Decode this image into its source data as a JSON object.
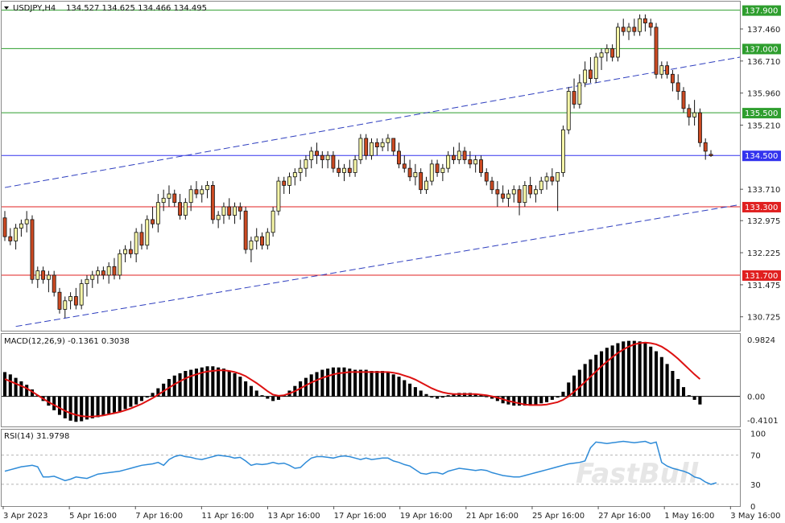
{
  "chart_data": {
    "type": "candlestick",
    "title": "USDJPY,H4",
    "header_values": "134.527 134.625 134.466 134.495",
    "price_axis": {
      "range": [
        130.4,
        138.1
      ],
      "ticks": [
        "137.460",
        "136.710",
        "135.960",
        "135.210",
        "133.710",
        "132.975",
        "132.225",
        "131.475",
        "130.725"
      ]
    },
    "x_labels": [
      "3 Apr 2023",
      "5 Apr 16:00",
      "7 Apr 16:00",
      "11 Apr 16:00",
      "13 Apr 16:00",
      "17 Apr 16:00",
      "19 Apr 16:00",
      "21 Apr 16:00",
      "25 Apr 16:00",
      "27 Apr 16:00",
      "1 May 16:00",
      "3 May 16:00"
    ],
    "levels": [
      {
        "value": 137.9,
        "label": "137.900",
        "color": "#2e9e2e"
      },
      {
        "value": 137.0,
        "label": "137.000",
        "color": "#2e9e2e"
      },
      {
        "value": 135.5,
        "label": "135.500",
        "color": "#2e9e2e"
      },
      {
        "value": 134.5,
        "label": "134.500",
        "color": "#3333ee"
      },
      {
        "value": 133.3,
        "label": "133.300",
        "color": "#e02020"
      },
      {
        "value": 131.7,
        "label": "131.700",
        "color": "#e02020"
      }
    ],
    "channel": [
      {
        "from": [
          0,
          133.75
        ],
        "to": [
          150,
          136.8
        ]
      },
      {
        "from": [
          2,
          130.5
        ],
        "to": [
          150,
          133.35
        ]
      }
    ],
    "candles": [
      [
        133.04,
        133.2,
        132.5,
        132.6
      ],
      [
        132.6,
        132.8,
        132.4,
        132.5
      ],
      [
        132.5,
        132.9,
        132.3,
        132.8
      ],
      [
        132.8,
        133.0,
        132.6,
        132.9
      ],
      [
        132.9,
        133.2,
        132.7,
        133.0
      ],
      [
        133.0,
        133.1,
        131.5,
        131.6
      ],
      [
        131.6,
        131.9,
        131.4,
        131.8
      ],
      [
        131.8,
        131.9,
        131.5,
        131.6
      ],
      [
        131.6,
        131.8,
        131.3,
        131.7
      ],
      [
        131.7,
        131.8,
        131.2,
        131.3
      ],
      [
        131.3,
        131.4,
        130.8,
        130.9
      ],
      [
        130.9,
        131.2,
        130.7,
        131.1
      ],
      [
        131.1,
        131.3,
        130.9,
        131.2
      ],
      [
        131.2,
        131.4,
        130.9,
        131.0
      ],
      [
        131.0,
        131.6,
        130.9,
        131.5
      ],
      [
        131.5,
        131.7,
        131.2,
        131.6
      ],
      [
        131.6,
        131.8,
        131.4,
        131.7
      ],
      [
        131.7,
        131.9,
        131.5,
        131.8
      ],
      [
        131.8,
        131.9,
        131.6,
        131.7
      ],
      [
        131.7,
        132.0,
        131.5,
        131.9
      ],
      [
        131.9,
        132.1,
        131.6,
        131.7
      ],
      [
        131.7,
        132.3,
        131.6,
        132.2
      ],
      [
        132.2,
        132.4,
        132.0,
        132.3
      ],
      [
        132.3,
        132.5,
        132.1,
        132.2
      ],
      [
        132.2,
        132.8,
        132.0,
        132.7
      ],
      [
        132.7,
        132.9,
        132.3,
        132.4
      ],
      [
        132.4,
        133.1,
        132.3,
        133.0
      ],
      [
        133.0,
        133.3,
        132.8,
        132.9
      ],
      [
        132.9,
        133.6,
        132.7,
        133.4
      ],
      [
        133.4,
        133.7,
        133.2,
        133.5
      ],
      [
        133.5,
        133.8,
        133.3,
        133.6
      ],
      [
        133.6,
        133.7,
        133.3,
        133.4
      ],
      [
        133.4,
        133.6,
        133.0,
        133.1
      ],
      [
        133.1,
        133.5,
        133.0,
        133.4
      ],
      [
        133.4,
        133.8,
        133.2,
        133.7
      ],
      [
        133.7,
        133.9,
        133.5,
        133.6
      ],
      [
        133.6,
        133.8,
        133.4,
        133.7
      ],
      [
        133.7,
        133.9,
        133.5,
        133.8
      ],
      [
        133.8,
        133.9,
        132.9,
        133.0
      ],
      [
        133.0,
        133.2,
        132.8,
        133.1
      ],
      [
        133.1,
        133.4,
        132.9,
        133.3
      ],
      [
        133.3,
        133.5,
        133.0,
        133.1
      ],
      [
        133.1,
        133.4,
        132.9,
        133.3
      ],
      [
        133.3,
        133.4,
        133.0,
        133.2
      ],
      [
        133.2,
        133.3,
        132.2,
        132.3
      ],
      [
        132.3,
        132.6,
        132.0,
        132.5
      ],
      [
        132.5,
        132.8,
        132.3,
        132.6
      ],
      [
        132.6,
        132.7,
        132.3,
        132.4
      ],
      [
        132.4,
        132.8,
        132.3,
        132.7
      ],
      [
        132.7,
        133.3,
        132.6,
        133.2
      ],
      [
        133.2,
        134.0,
        133.1,
        133.9
      ],
      [
        133.9,
        134.0,
        133.6,
        133.8
      ],
      [
        133.8,
        134.1,
        133.6,
        134.0
      ],
      [
        134.0,
        134.2,
        133.8,
        134.1
      ],
      [
        134.1,
        134.4,
        133.9,
        134.2
      ],
      [
        134.2,
        134.5,
        134.0,
        134.4
      ],
      [
        134.4,
        134.7,
        134.2,
        134.6
      ],
      [
        134.6,
        134.8,
        134.3,
        134.5
      ],
      [
        134.5,
        134.6,
        134.2,
        134.4
      ],
      [
        134.4,
        134.6,
        134.2,
        134.5
      ],
      [
        134.5,
        134.6,
        134.1,
        134.2
      ],
      [
        134.2,
        134.4,
        134.0,
        134.1
      ],
      [
        134.1,
        134.3,
        133.9,
        134.2
      ],
      [
        134.2,
        134.4,
        134.0,
        134.1
      ],
      [
        134.1,
        134.5,
        134.0,
        134.4
      ],
      [
        134.4,
        135.0,
        134.3,
        134.9
      ],
      [
        134.9,
        135.0,
        134.4,
        134.5
      ],
      [
        134.5,
        134.9,
        134.4,
        134.8
      ],
      [
        134.8,
        134.9,
        134.5,
        134.7
      ],
      [
        134.7,
        134.9,
        134.6,
        134.8
      ],
      [
        134.8,
        135.0,
        134.6,
        134.9
      ],
      [
        134.9,
        134.9,
        134.5,
        134.6
      ],
      [
        134.6,
        134.8,
        134.2,
        134.3
      ],
      [
        134.3,
        134.5,
        134.1,
        134.2
      ],
      [
        134.2,
        134.4,
        133.9,
        134.0
      ],
      [
        134.0,
        134.3,
        133.8,
        134.1
      ],
      [
        134.1,
        134.2,
        133.6,
        133.7
      ],
      [
        133.7,
        134.0,
        133.6,
        133.9
      ],
      [
        133.9,
        134.4,
        133.8,
        134.3
      ],
      [
        134.3,
        134.4,
        134.0,
        134.1
      ],
      [
        134.1,
        134.3,
        133.9,
        134.2
      ],
      [
        134.2,
        134.6,
        134.1,
        134.5
      ],
      [
        134.5,
        134.7,
        134.3,
        134.4
      ],
      [
        134.4,
        134.8,
        134.3,
        134.6
      ],
      [
        134.6,
        134.7,
        134.3,
        134.4
      ],
      [
        134.4,
        134.6,
        134.2,
        134.3
      ],
      [
        134.3,
        134.5,
        134.1,
        134.4
      ],
      [
        134.4,
        134.5,
        134.0,
        134.1
      ],
      [
        134.1,
        134.2,
        133.8,
        133.9
      ],
      [
        133.9,
        134.0,
        133.6,
        133.7
      ],
      [
        133.7,
        133.9,
        133.3,
        133.6
      ],
      [
        133.6,
        133.8,
        133.4,
        133.5
      ],
      [
        133.5,
        133.7,
        133.3,
        133.6
      ],
      [
        133.6,
        133.8,
        133.4,
        133.7
      ],
      [
        133.7,
        133.8,
        133.1,
        133.4
      ],
      [
        133.4,
        133.9,
        133.3,
        133.8
      ],
      [
        133.8,
        134.0,
        133.5,
        133.6
      ],
      [
        133.6,
        133.8,
        133.4,
        133.7
      ],
      [
        133.7,
        134.0,
        133.6,
        133.9
      ],
      [
        133.9,
        134.1,
        133.7,
        134.0
      ],
      [
        134.0,
        134.2,
        133.8,
        133.9
      ],
      [
        133.9,
        134.1,
        133.2,
        134.1
      ],
      [
        134.1,
        135.2,
        134.0,
        135.1
      ],
      [
        135.1,
        136.1,
        135.0,
        136.0
      ],
      [
        136.0,
        136.3,
        135.6,
        135.7
      ],
      [
        135.7,
        136.4,
        135.6,
        136.2
      ],
      [
        136.2,
        136.7,
        136.1,
        136.5
      ],
      [
        136.5,
        136.8,
        136.2,
        136.3
      ],
      [
        136.3,
        136.9,
        136.2,
        136.8
      ],
      [
        136.8,
        137.0,
        136.5,
        136.9
      ],
      [
        136.9,
        137.1,
        136.7,
        137.0
      ],
      [
        137.0,
        137.1,
        136.7,
        136.8
      ],
      [
        136.8,
        137.6,
        136.7,
        137.5
      ],
      [
        137.5,
        137.7,
        137.3,
        137.4
      ],
      [
        137.4,
        137.6,
        137.2,
        137.5
      ],
      [
        137.5,
        137.7,
        137.3,
        137.4
      ],
      [
        137.4,
        137.8,
        137.3,
        137.7
      ],
      [
        137.7,
        137.8,
        137.4,
        137.6
      ],
      [
        137.6,
        137.7,
        137.3,
        137.5
      ],
      [
        137.5,
        137.6,
        136.3,
        136.4
      ],
      [
        136.4,
        136.7,
        136.3,
        136.6
      ],
      [
        136.6,
        136.7,
        136.3,
        136.4
      ],
      [
        136.4,
        136.5,
        136.0,
        136.2
      ],
      [
        136.2,
        136.4,
        135.8,
        136.0
      ],
      [
        136.0,
        136.1,
        135.5,
        135.6
      ],
      [
        135.6,
        135.7,
        135.2,
        135.4
      ],
      [
        135.4,
        135.8,
        135.2,
        135.5
      ],
      [
        135.5,
        135.6,
        134.7,
        134.8
      ],
      [
        134.8,
        134.9,
        134.4,
        134.6
      ],
      [
        134.527,
        134.625,
        134.466,
        134.495
      ]
    ],
    "macd": {
      "label": "MACD(12,26,9) -0.1361 0.3038",
      "range": [
        -0.52,
        1.08
      ],
      "ticks": [
        "0.9824",
        "0.00",
        "-0.4101"
      ],
      "histogram": [
        0.42,
        0.38,
        0.32,
        0.26,
        0.2,
        0.12,
        0.02,
        -0.08,
        -0.16,
        -0.24,
        -0.32,
        -0.38,
        -0.42,
        -0.44,
        -0.43,
        -0.4,
        -0.38,
        -0.36,
        -0.33,
        -0.3,
        -0.28,
        -0.26,
        -0.22,
        -0.18,
        -0.14,
        -0.08,
        -0.02,
        0.06,
        0.14,
        0.22,
        0.3,
        0.36,
        0.4,
        0.44,
        0.46,
        0.48,
        0.5,
        0.52,
        0.52,
        0.5,
        0.48,
        0.44,
        0.4,
        0.34,
        0.26,
        0.18,
        0.1,
        0.02,
        -0.04,
        -0.08,
        -0.06,
        0.02,
        0.1,
        0.18,
        0.26,
        0.32,
        0.38,
        0.42,
        0.46,
        0.48,
        0.5,
        0.5,
        0.5,
        0.48,
        0.46,
        0.46,
        0.46,
        0.44,
        0.44,
        0.44,
        0.42,
        0.38,
        0.34,
        0.28,
        0.22,
        0.16,
        0.1,
        0.04,
        -0.02,
        -0.04,
        -0.02,
        0.02,
        0.04,
        0.06,
        0.06,
        0.06,
        0.05,
        0.03,
        0.0,
        -0.04,
        -0.08,
        -0.12,
        -0.14,
        -0.16,
        -0.16,
        -0.16,
        -0.16,
        -0.14,
        -0.12,
        -0.1,
        -0.06,
        -0.02,
        0.08,
        0.24,
        0.36,
        0.46,
        0.56,
        0.64,
        0.72,
        0.78,
        0.84,
        0.88,
        0.92,
        0.95,
        0.96,
        0.96,
        0.95,
        0.92,
        0.86,
        0.78,
        0.68,
        0.56,
        0.44,
        0.3,
        0.16,
        0.02,
        -0.06,
        -0.14
      ],
      "signal": [
        0.3,
        0.26,
        0.22,
        0.18,
        0.14,
        0.08,
        0.02,
        -0.04,
        -0.1,
        -0.15,
        -0.2,
        -0.25,
        -0.29,
        -0.32,
        -0.34,
        -0.35,
        -0.35,
        -0.34,
        -0.33,
        -0.31,
        -0.29,
        -0.27,
        -0.24,
        -0.21,
        -0.17,
        -0.13,
        -0.08,
        -0.03,
        0.03,
        0.09,
        0.15,
        0.21,
        0.26,
        0.31,
        0.35,
        0.38,
        0.41,
        0.43,
        0.44,
        0.45,
        0.45,
        0.44,
        0.42,
        0.39,
        0.35,
        0.29,
        0.23,
        0.16,
        0.09,
        0.03,
        0.01,
        0.02,
        0.05,
        0.09,
        0.14,
        0.19,
        0.24,
        0.28,
        0.32,
        0.35,
        0.38,
        0.4,
        0.41,
        0.42,
        0.42,
        0.42,
        0.42,
        0.42,
        0.42,
        0.42,
        0.42,
        0.41,
        0.39,
        0.36,
        0.33,
        0.29,
        0.24,
        0.19,
        0.14,
        0.1,
        0.07,
        0.05,
        0.04,
        0.04,
        0.04,
        0.04,
        0.04,
        0.03,
        0.02,
        0.0,
        -0.02,
        -0.05,
        -0.08,
        -0.1,
        -0.12,
        -0.14,
        -0.15,
        -0.15,
        -0.15,
        -0.14,
        -0.12,
        -0.1,
        -0.06,
        0.0,
        0.08,
        0.16,
        0.25,
        0.34,
        0.43,
        0.52,
        0.6,
        0.68,
        0.75,
        0.81,
        0.86,
        0.9,
        0.92,
        0.93,
        0.92,
        0.9,
        0.86,
        0.8,
        0.73,
        0.65,
        0.56,
        0.47,
        0.38,
        0.3
      ]
    },
    "rsi": {
      "label": "RSI(14) 31.9798",
      "range": [
        0,
        105
      ],
      "ticks": [
        "100",
        "70",
        "30",
        "0"
      ],
      "levels": [
        70,
        30
      ],
      "values": [
        48,
        50,
        52,
        54,
        55,
        56,
        54,
        40,
        40,
        41,
        38,
        35,
        37,
        40,
        39,
        38,
        41,
        44,
        45,
        46,
        47,
        48,
        50,
        52,
        54,
        56,
        57,
        58,
        60,
        56,
        64,
        68,
        70,
        68,
        67,
        65,
        64,
        66,
        68,
        70,
        69,
        68,
        66,
        67,
        62,
        56,
        58,
        57,
        58,
        60,
        58,
        59,
        56,
        52,
        53,
        60,
        66,
        68,
        68,
        67,
        66,
        68,
        69,
        68,
        66,
        64,
        66,
        64,
        65,
        66,
        66,
        62,
        60,
        57,
        55,
        50,
        45,
        44,
        46,
        46,
        44,
        48,
        50,
        52,
        51,
        50,
        49,
        50,
        49,
        46,
        44,
        42,
        41,
        40,
        40,
        42,
        44,
        46,
        48,
        50,
        52,
        54,
        56,
        58,
        59,
        60,
        62,
        80,
        88,
        87,
        86,
        87,
        88,
        89,
        88,
        87,
        88,
        89,
        86,
        88,
        60,
        55,
        52,
        50,
        48,
        45,
        40,
        38,
        33,
        30,
        32
      ]
    },
    "watermark": "FastBull",
    "colors": {
      "bull_body": "#f7f7a8",
      "bear_body": "#cc4a22",
      "wick": "#111111",
      "macd_signal": "#dd1111",
      "rsi_line": "#2e8bd8"
    }
  }
}
